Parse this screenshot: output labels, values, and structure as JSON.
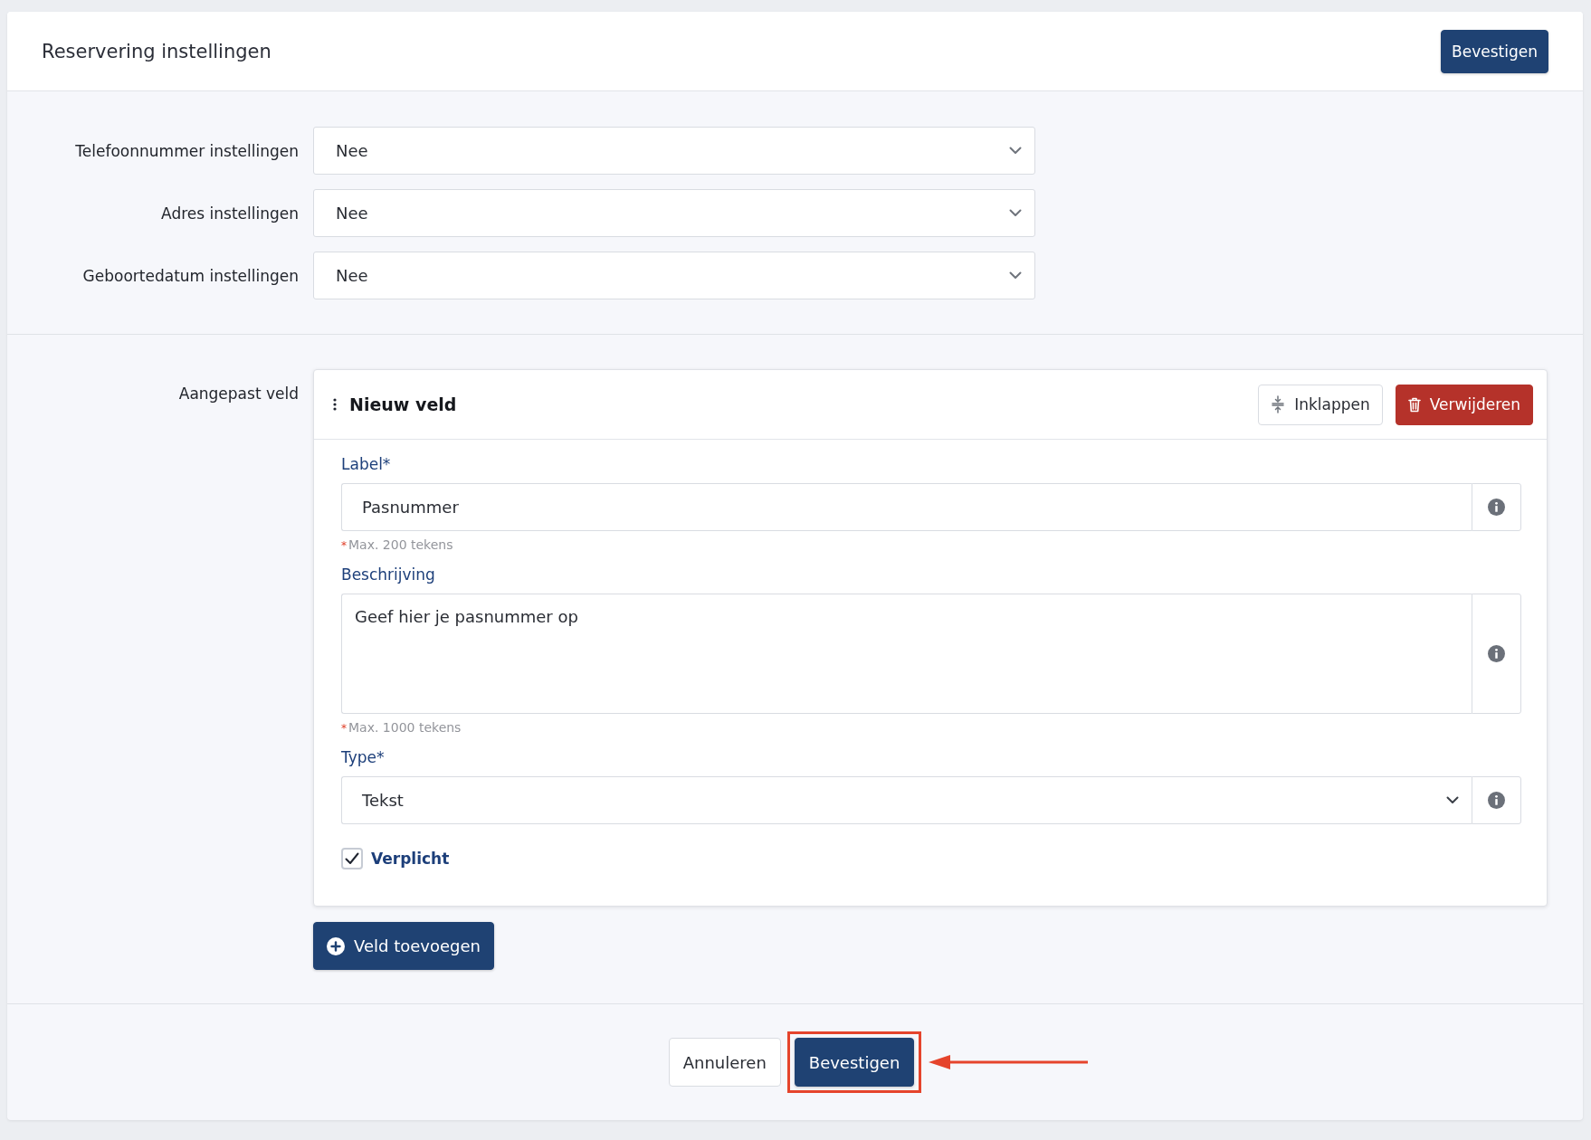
{
  "header": {
    "title": "Reservering instellingen",
    "button": "Bevestigen"
  },
  "settings": [
    {
      "label": "Telefoonnummer instellingen",
      "value": "Nee"
    },
    {
      "label": "Adres instellingen",
      "value": "Nee"
    },
    {
      "label": "Geboortedatum instellingen",
      "value": "Nee"
    }
  ],
  "custom_fields": {
    "label": "Aangepast veld",
    "fields": [
      {
        "title": "Nieuw veld",
        "collapse_button": "Inklappen",
        "delete_button": "Verwijderen",
        "inputs": [
          {
            "kind": "text",
            "label": "Label*",
            "value": "Pasnummer",
            "hint": {
              "mark": "*",
              "text": "Max. 200 tekens"
            }
          },
          {
            "kind": "textarea",
            "label": "Beschrijving",
            "value": "Geef hier je pasnummer op",
            "hint": {
              "mark": "*",
              "text": "Max. 1000 tekens"
            }
          },
          {
            "kind": "select",
            "label": "Type*",
            "value": "Tekst"
          }
        ],
        "required": {
          "label": "Verplicht",
          "checked": true
        }
      }
    ],
    "add_button": "Veld toevoegen"
  },
  "footer": {
    "buttons": [
      {
        "label": "Annuleren",
        "kind": "secondary",
        "highlighted": false
      },
      {
        "label": "Bevestigen",
        "kind": "primary",
        "highlighted": true
      }
    ]
  }
}
